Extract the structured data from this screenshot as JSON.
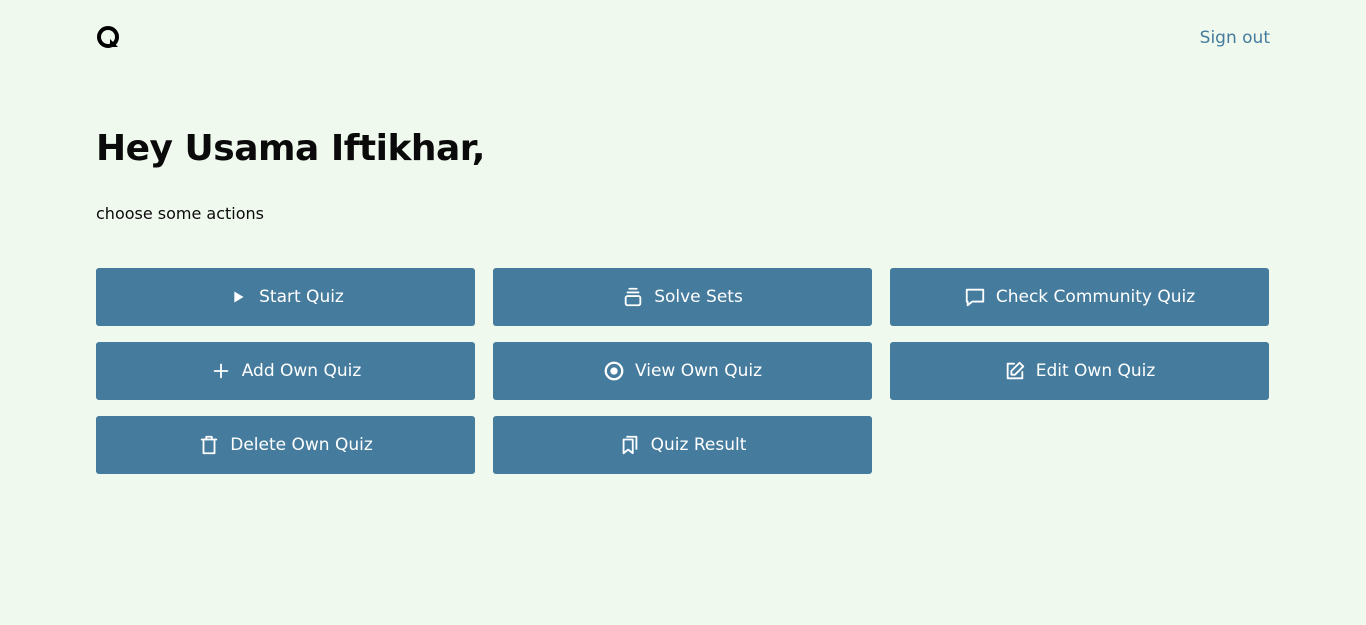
{
  "header": {
    "logo_icon": "logo-icon",
    "signout_label": "Sign out"
  },
  "main": {
    "greeting": "Hey Usama Iftikhar,",
    "subtitle": "choose some actions",
    "actions": [
      {
        "label": "Start Quiz",
        "icon": "play-icon"
      },
      {
        "label": "Solve Sets",
        "icon": "stack-icon"
      },
      {
        "label": "Check Community Quiz",
        "icon": "chat-icon"
      },
      {
        "label": "Add Own Quiz",
        "icon": "plus-icon"
      },
      {
        "label": "View Own Quiz",
        "icon": "target-icon"
      },
      {
        "label": "Edit Own Quiz",
        "icon": "edit-icon"
      },
      {
        "label": "Delete Own Quiz",
        "icon": "trash-icon"
      },
      {
        "label": "Quiz Result",
        "icon": "bookmarks-icon"
      }
    ]
  },
  "colors": {
    "background": "#f0f9ee",
    "accent": "#457b9d",
    "text": "#0a0a0a"
  }
}
